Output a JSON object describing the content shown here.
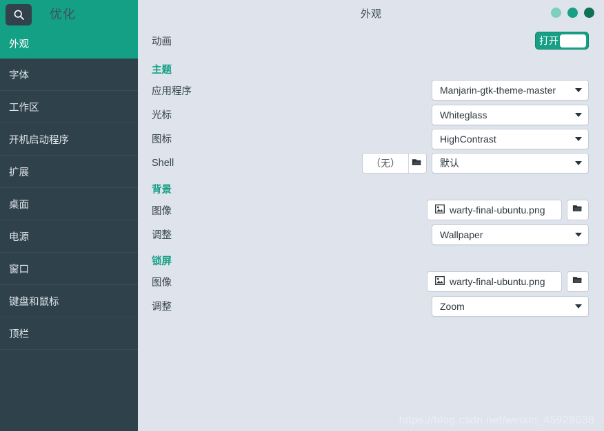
{
  "app": {
    "title": "优化",
    "window_title": "外观",
    "search_icon": "search-icon"
  },
  "window_controls": [
    {
      "name": "minimize-button",
      "color": "#7ecfbd"
    },
    {
      "name": "maximize-button",
      "color": "#17a085"
    },
    {
      "name": "close-button",
      "color": "#107054"
    }
  ],
  "sidebar": {
    "active_item": "外观",
    "items": [
      {
        "label": "外观",
        "active": true
      },
      {
        "label": "字体",
        "active": false
      },
      {
        "label": "工作区",
        "active": false
      },
      {
        "label": "开机启动程序",
        "active": false
      },
      {
        "label": "扩展",
        "active": false
      },
      {
        "label": "桌面",
        "active": false
      },
      {
        "label": "电源",
        "active": false
      },
      {
        "label": "窗口",
        "active": false
      },
      {
        "label": "键盘和鼠标",
        "active": false
      },
      {
        "label": "顶栏",
        "active": false
      }
    ]
  },
  "main": {
    "animation": {
      "label": "动画",
      "toggle_label": "打开",
      "toggle_state": "on"
    },
    "theme": {
      "section": "主题",
      "application": {
        "label": "应用程序",
        "value": "Manjarin-gtk-theme-master"
      },
      "cursor": {
        "label": "光标",
        "value": "Whiteglass"
      },
      "icons": {
        "label": "图标",
        "value": "HighContrast"
      },
      "shell": {
        "label": "Shell",
        "file_value": "（无）",
        "value": "默认"
      }
    },
    "background": {
      "section": "背景",
      "image": {
        "label": "图像",
        "value": "warty-final-ubuntu.png"
      },
      "adjustment": {
        "label": "调整",
        "value": "Wallpaper"
      }
    },
    "lockscreen": {
      "section": "锁屏",
      "image": {
        "label": "图像",
        "value": "warty-final-ubuntu.png"
      },
      "adjustment": {
        "label": "调整",
        "value": "Zoom"
      }
    }
  },
  "watermark": "https://blog.csdn.net/weixin_45929038",
  "colors": {
    "accent": "#17a085",
    "sidebar_bg": "#2f414b",
    "content_bg": "#dfe4ec"
  }
}
